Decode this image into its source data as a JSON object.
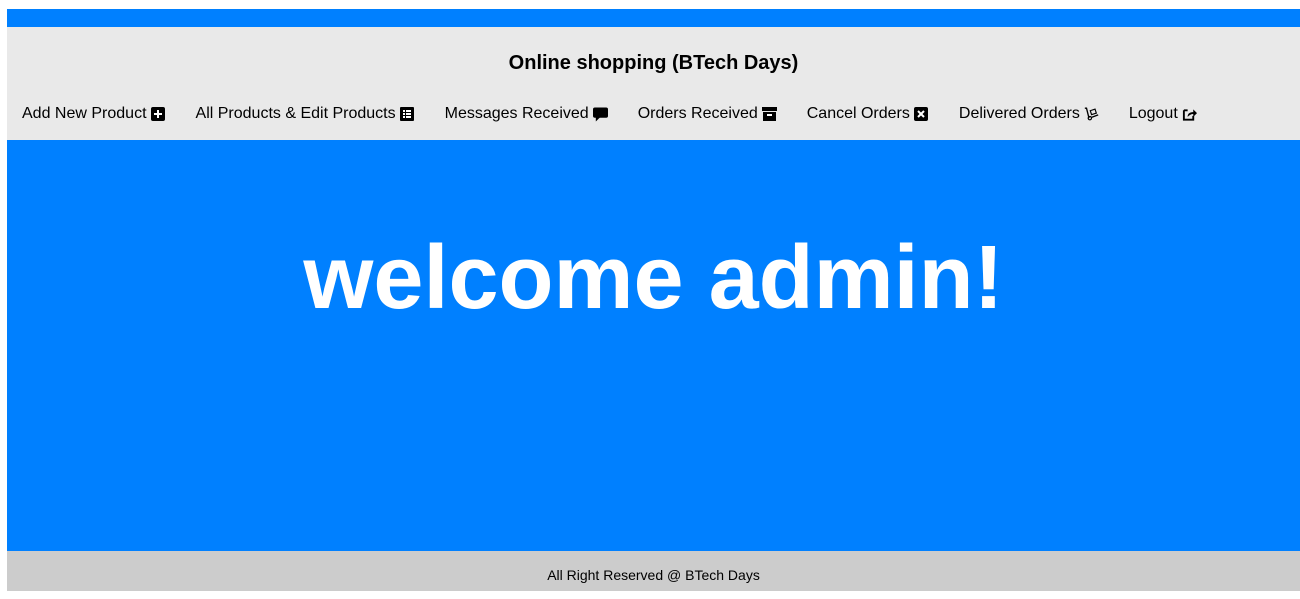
{
  "header": {
    "title": "Online shopping (BTech Days)"
  },
  "nav": {
    "items": [
      {
        "label": "Add New Product",
        "icon": "plus-square-icon"
      },
      {
        "label": "All Products & Edit Products",
        "icon": "list-alt-icon"
      },
      {
        "label": "Messages Received",
        "icon": "comment-icon"
      },
      {
        "label": "Orders Received",
        "icon": "archive-icon"
      },
      {
        "label": "Cancel Orders",
        "icon": "close-square-icon"
      },
      {
        "label": "Delivered Orders",
        "icon": "dolly-icon"
      },
      {
        "label": "Logout",
        "icon": "share-square-icon"
      }
    ]
  },
  "main": {
    "welcome": "welcome admin!"
  },
  "footer": {
    "text": "All Right Reserved @ BTech Days"
  },
  "colors": {
    "primary": "#0080ff",
    "header_bg": "#e9e9e9",
    "footer_bg": "#cccccc"
  }
}
